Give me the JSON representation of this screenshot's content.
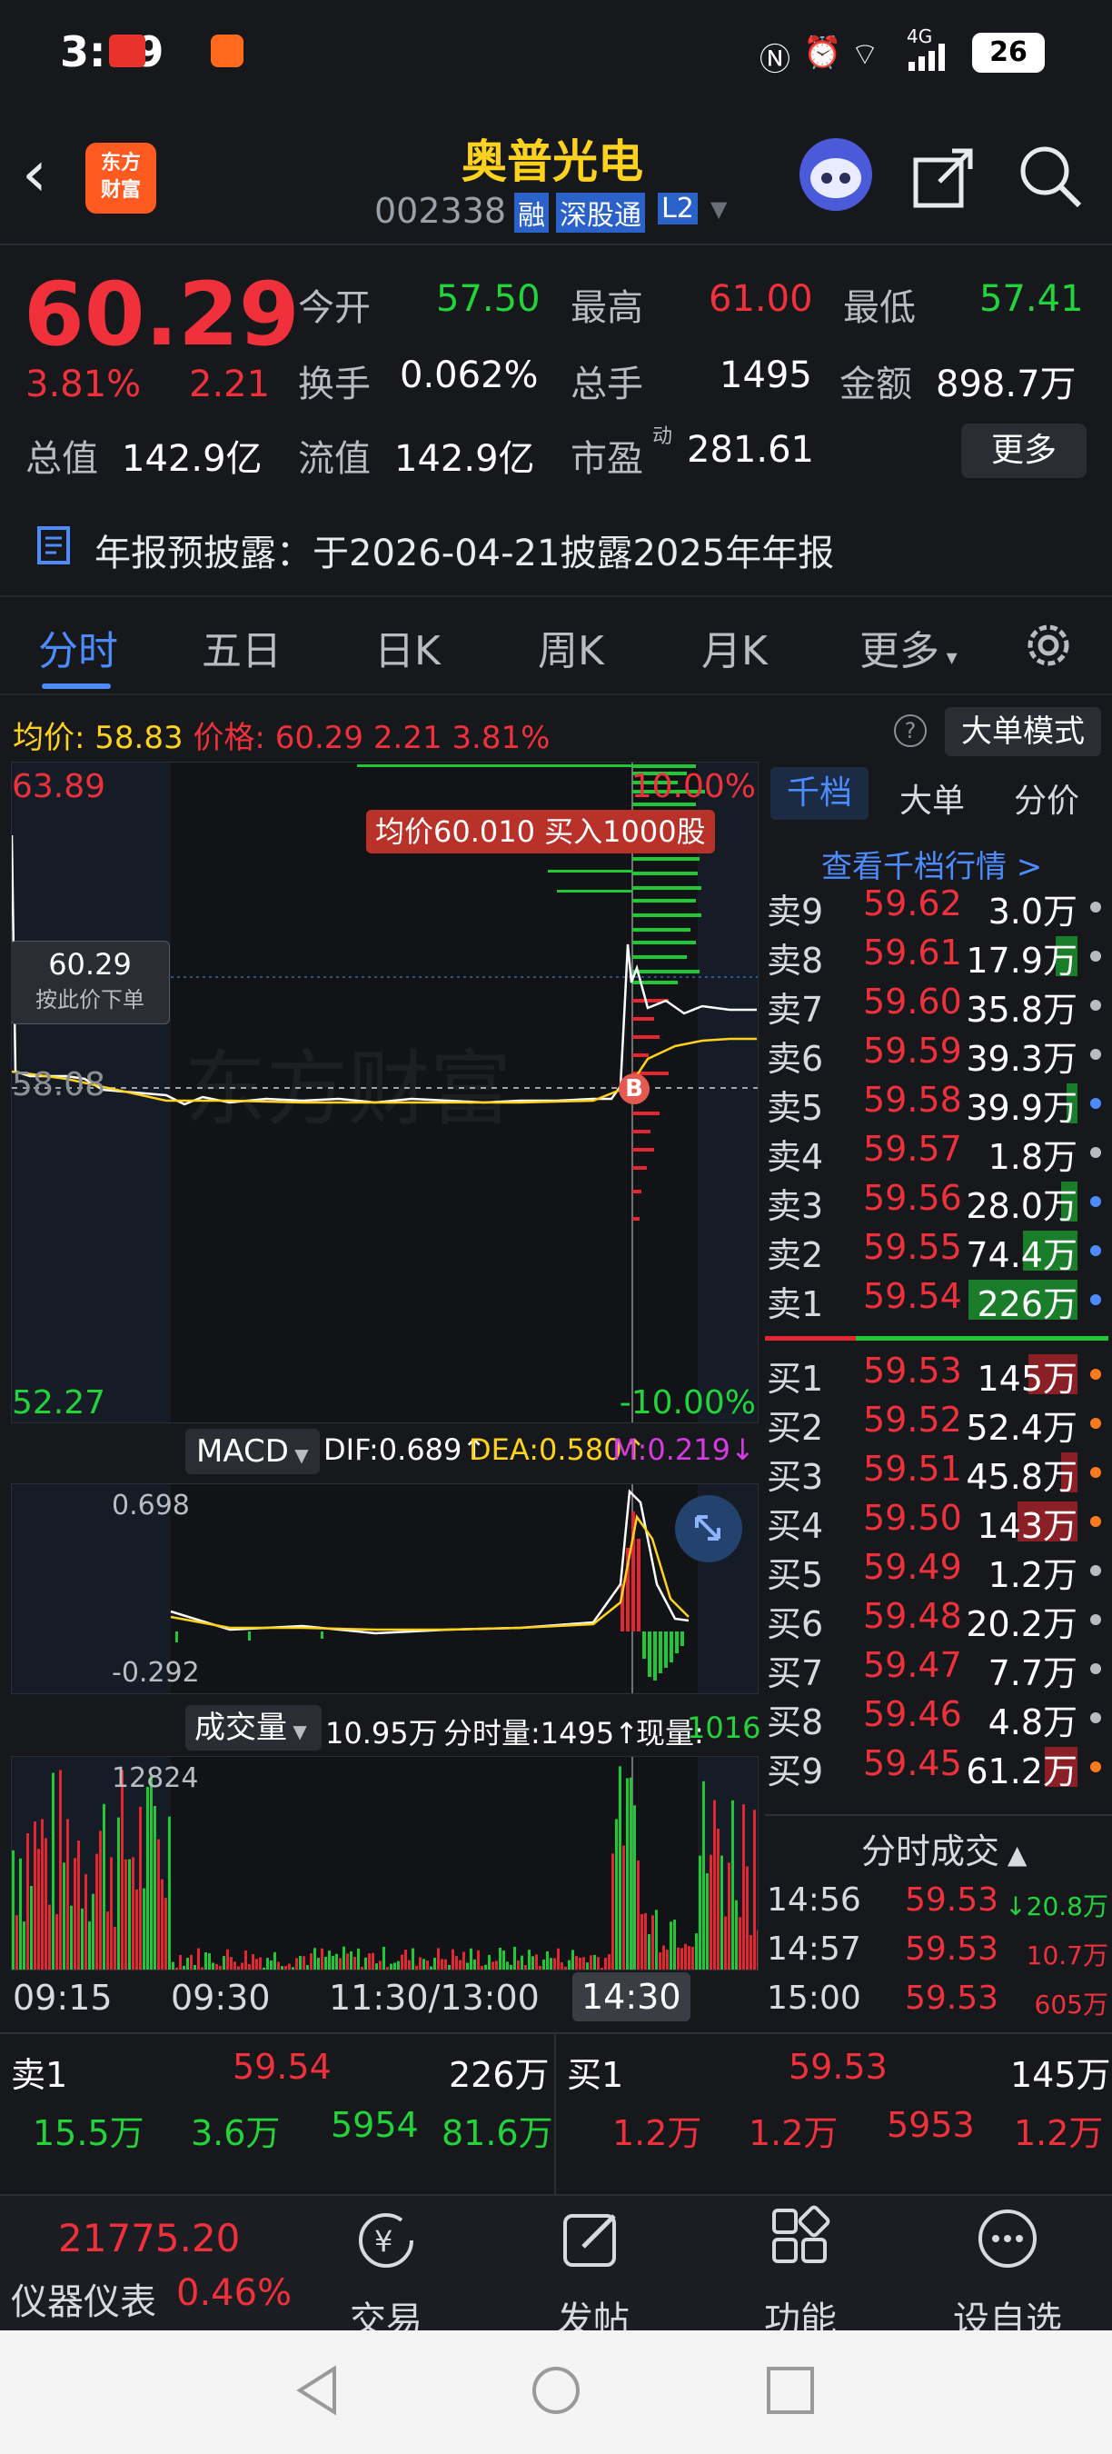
{
  "status_bar": {
    "time": "3:19",
    "battery": "26",
    "network": "4G"
  },
  "header": {
    "logo_text": "东方财富",
    "stock_name": "奥普光电",
    "stock_code": "002338",
    "tags": [
      "融",
      "深股通",
      "L2"
    ]
  },
  "quote": {
    "price": "60.29",
    "change_pct": "3.81%",
    "change": "2.21",
    "open_label": "今开",
    "open": "57.50",
    "high_label": "最高",
    "high": "61.00",
    "low_label": "最低",
    "low": "57.41",
    "turnover_label": "换手",
    "turnover": "0.062%",
    "volume_label": "总手",
    "volume": "1495",
    "amount_label": "金额",
    "amount": "898.7万",
    "mcap_label": "总值",
    "mcap": "142.9亿",
    "float_label": "流值",
    "float_cap": "142.9亿",
    "pe_label": "市盈",
    "pe_sup": "动",
    "pe": "281.61",
    "more_button": "更多"
  },
  "notice": {
    "text": "年报预披露：于2026-04-21披露2025年年报"
  },
  "tabs": [
    "分时",
    "五日",
    "日K",
    "周K",
    "月K",
    "更多"
  ],
  "info_line": {
    "avg_label": "均价:",
    "avg": "58.83",
    "price_label": "价格:",
    "price": "60.29",
    "change": "2.21",
    "change_pct": "3.81%",
    "big_order_mode": "大单模式",
    "help": "?"
  },
  "chart": {
    "y_high": "63.89",
    "y_mid": "58.08",
    "y_low": "52.27",
    "pct_high": "10.00%",
    "pct_low": "-10.00%",
    "tooltip_price": "60.29",
    "tooltip_hint": "按此价下单",
    "banner": "均价60.010  买入1000股",
    "buy_marker": "B",
    "watermark": "东方财富"
  },
  "macd": {
    "label": "MACD",
    "dif": "DIF:0.689↑",
    "dea": "DEA:0.580↑",
    "m": "M:0.219↓",
    "top": "0.698",
    "bottom": "-0.292"
  },
  "volume": {
    "label": "成交量",
    "total": "10.95万",
    "minute_vol": "分时量:1495↑",
    "now_label": "现量:",
    "now": "1016",
    "max": "12824"
  },
  "time_axis": [
    "09:15",
    "09:30",
    "11:30/13:00",
    "14:30"
  ],
  "orderbook": {
    "tabs": [
      "千档",
      "大单",
      "分价"
    ],
    "view_more": "查看千档行情 >",
    "asks": [
      {
        "name": "卖9",
        "price": "59.62",
        "vol": "3.0万"
      },
      {
        "name": "卖8",
        "price": "59.61",
        "vol": "17.9万"
      },
      {
        "name": "卖7",
        "price": "59.60",
        "vol": "35.8万"
      },
      {
        "name": "卖6",
        "price": "59.59",
        "vol": "39.3万"
      },
      {
        "name": "卖5",
        "price": "59.58",
        "vol": "39.9万"
      },
      {
        "name": "卖4",
        "price": "59.57",
        "vol": "1.8万"
      },
      {
        "name": "卖3",
        "price": "59.56",
        "vol": "28.0万"
      },
      {
        "name": "卖2",
        "price": "59.55",
        "vol": "74.4万"
      },
      {
        "name": "卖1",
        "price": "59.54",
        "vol": "226万"
      }
    ],
    "bids": [
      {
        "name": "买1",
        "price": "59.53",
        "vol": "145万"
      },
      {
        "name": "买2",
        "price": "59.52",
        "vol": "52.4万"
      },
      {
        "name": "买3",
        "price": "59.51",
        "vol": "45.8万"
      },
      {
        "name": "买4",
        "price": "59.50",
        "vol": "143万"
      },
      {
        "name": "买5",
        "price": "59.49",
        "vol": "1.2万"
      },
      {
        "name": "买6",
        "price": "59.48",
        "vol": "20.2万"
      },
      {
        "name": "买7",
        "price": "59.47",
        "vol": "7.7万"
      },
      {
        "name": "买8",
        "price": "59.46",
        "vol": "4.8万"
      },
      {
        "name": "买9",
        "price": "59.45",
        "vol": "61.2万"
      }
    ],
    "ticks_title": "分时成交",
    "ticks": [
      {
        "time": "14:56",
        "price": "59.53",
        "vol": "↓20.8万"
      },
      {
        "time": "14:57",
        "price": "59.53",
        "vol": "10.7万"
      },
      {
        "time": "15:00",
        "price": "59.53",
        "vol": "605万"
      }
    ]
  },
  "bottom_book": {
    "sell_label": "卖1",
    "sell_price": "59.54",
    "sell_vol": "226万",
    "buy_label": "买1",
    "buy_price": "59.53",
    "buy_vol": "145万",
    "sell_row": [
      "15.5万",
      "3.6万",
      "5954",
      "81.6万"
    ],
    "buy_row": [
      "1.2万",
      "1.2万",
      "5953",
      "1.2万"
    ]
  },
  "index": {
    "value": "21775.20",
    "name": "仪器仪表",
    "pct": "0.46%"
  },
  "nav": [
    "交易",
    "发帖",
    "功能",
    "设自选"
  ]
}
